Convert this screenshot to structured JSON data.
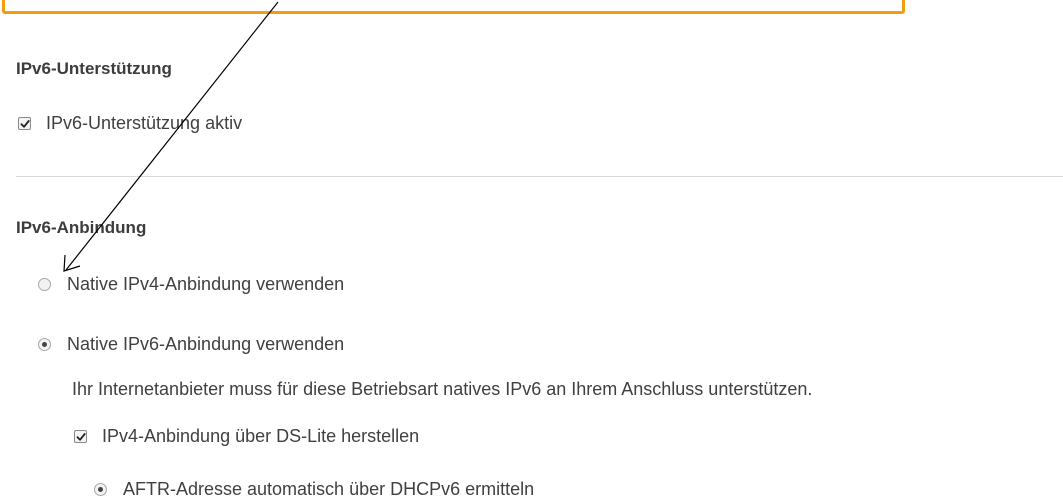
{
  "support": {
    "heading": "IPv6-Unterstützung",
    "checkbox_label": "IPv6-Unterstützung aktiv",
    "checkbox_checked": true
  },
  "connection": {
    "heading": "IPv6-Anbindung",
    "option_native_ipv4": {
      "label": "Native IPv4-Anbindung verwenden",
      "selected": false
    },
    "option_native_ipv6": {
      "label": "Native IPv6-Anbindung verwenden",
      "selected": true,
      "hint": "Ihr Internetanbieter muss für diese Betriebsart natives IPv6 an Ihrem Anschluss unterstützen."
    },
    "ds_lite": {
      "label": "IPv4-Anbindung über DS-Lite herstellen",
      "checked": true
    },
    "aftr_auto": {
      "label": "AFTR-Adresse automatisch über DHCPv6 ermitteln",
      "selected": true
    }
  },
  "annotation": {
    "callout_color": "#f39c12",
    "arrow_color": "#000000"
  },
  "icons": {
    "checkbox_checked": "checkmark-icon",
    "radio_selected": "radio-dot-icon"
  }
}
